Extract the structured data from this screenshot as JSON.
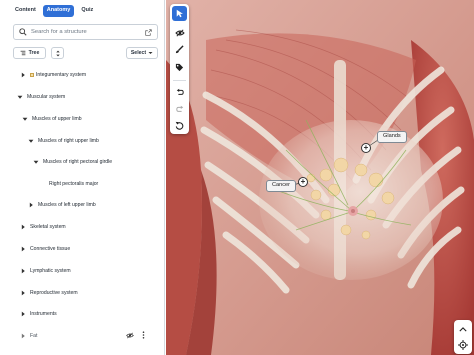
{
  "tabs": [
    {
      "label": "Content",
      "active": false
    },
    {
      "label": "Anatomy",
      "active": true
    },
    {
      "label": "Quiz",
      "active": false
    }
  ],
  "search": {
    "placeholder": "Search for a structure"
  },
  "controls": {
    "tree_label": "Tree",
    "select_label": "Select"
  },
  "tree": {
    "integumentary": "Integumentary system",
    "muscular": "Muscular system",
    "upper_limb": "Muscles of upper limb",
    "right_upper_limb": "Muscles of right upper limb",
    "right_pectoral": "Muscles of right pectoral girdle",
    "pectoralis": "Right pectoralis major",
    "left_upper_limb": "Muscles of left upper limb",
    "skeletal": "Skeletal system",
    "connective": "Connective tissue",
    "lymphatic": "Lymphatic system",
    "reproductive": "Reproductive system",
    "instruments": "Instruments",
    "fat": "Fat"
  },
  "viewer": {
    "labels": {
      "glands": "Glands",
      "cancer": "Cancer"
    }
  },
  "colors": {
    "accent": "#2f6fd6",
    "skin": "#d9a49a",
    "muscle": "#b9453f",
    "bone": "#efe6dc"
  },
  "icons": {
    "toolbar": [
      "cursor-icon",
      "hide-eye-icon",
      "paint-brush-icon",
      "tag-icon",
      "undo-icon",
      "redo-icon",
      "reset-icon"
    ],
    "corner": [
      "chevron-up-icon",
      "crosshair-icon"
    ]
  }
}
